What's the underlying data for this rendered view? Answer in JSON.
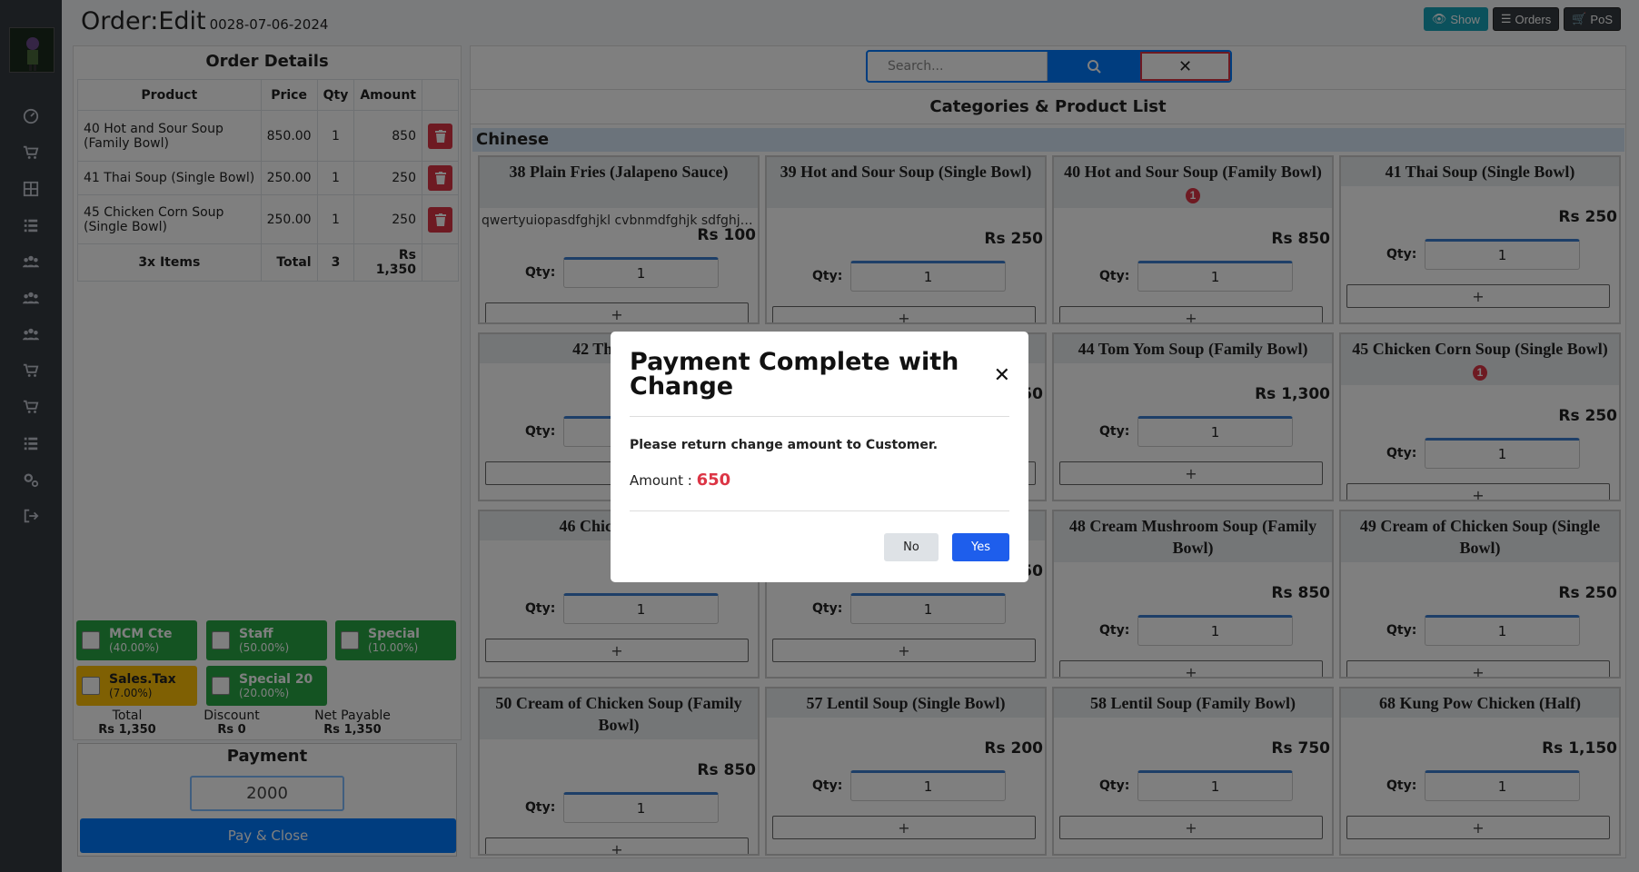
{
  "header": {
    "title": "Order:Edit",
    "order_number": "0028-07-06-2024",
    "show_label": "Show",
    "orders_label": "Orders",
    "pos_label": "PoS"
  },
  "order_panel": {
    "title": "Order Details",
    "columns": [
      "Product",
      "Price",
      "Qty",
      "Amount"
    ],
    "rows": [
      {
        "product": "40 Hot and Sour Soup (Family Bowl)",
        "price": "850.00",
        "qty": "1",
        "amount": "850"
      },
      {
        "product": "41 Thai Soup (Single Bowl)",
        "price": "250.00",
        "qty": "1",
        "amount": "250"
      },
      {
        "product": "45 Chicken Corn Soup (Single Bowl)",
        "price": "250.00",
        "qty": "1",
        "amount": "250"
      }
    ],
    "footer": {
      "items": "3x Items",
      "total_label": "Total",
      "qty": "3",
      "amount": "Rs 1,350"
    }
  },
  "discounts": [
    {
      "name": "MCM Cte",
      "percent": "(40.00%)"
    },
    {
      "name": "Staff",
      "percent": "(50.00%)"
    },
    {
      "name": "Special",
      "percent": "(10.00%)"
    },
    {
      "name": "Sales.Tax",
      "percent": "(7.00%)"
    },
    {
      "name": "Special 20",
      "percent": "(20.00%)"
    }
  ],
  "totals": {
    "total_label": "Total",
    "total_value": "Rs 1,350",
    "discount_label": "Discount",
    "discount_value": "Rs 0",
    "net_label": "Net Payable",
    "net_value": "Rs 1,350"
  },
  "payment": {
    "title": "Payment",
    "amount": "2000",
    "pay_close_label": "Pay & Close"
  },
  "search": {
    "placeholder": "Search..."
  },
  "products": {
    "title": "Categories & Product List",
    "category": "Chinese",
    "qty_label": "Qty:",
    "qty_value": "1",
    "add_label": "+",
    "cards": [
      {
        "name": "38 Plain Fries (Jalapeno Sauce)",
        "desc": "qwertyuiopasdfghjkl cvbnmdfghjk sdfghjcx...",
        "price": "Rs 100",
        "badge": ""
      },
      {
        "name": "39 Hot and Sour Soup (Single Bowl)",
        "desc": "",
        "price": "Rs 250",
        "badge": ""
      },
      {
        "name": "40 Hot and Sour Soup (Family Bowl)",
        "desc": "",
        "price": "Rs 850",
        "badge": "1"
      },
      {
        "name": "41 Thai Soup (Single Bowl)",
        "desc": "",
        "price": "Rs 250",
        "badge": ""
      },
      {
        "name": "42 Thai Soup",
        "desc": "",
        "price": "",
        "badge": ""
      },
      {
        "name": "",
        "desc": "",
        "price": "50",
        "badge": ""
      },
      {
        "name": "44 Tom Yom Soup (Family Bowl)",
        "desc": "",
        "price": "Rs 1,300",
        "badge": ""
      },
      {
        "name": "45 Chicken Corn Soup (Single Bowl)",
        "desc": "",
        "price": "Rs 250",
        "badge": "1"
      },
      {
        "name": "46 Chicken Corn",
        "desc": "",
        "price": "",
        "badge": ""
      },
      {
        "name": "",
        "desc": "",
        "price": "250",
        "badge": ""
      },
      {
        "name": "48 Cream Mushroom Soup (Family Bowl)",
        "desc": "",
        "price": "Rs 850",
        "badge": ""
      },
      {
        "name": "49 Cream of Chicken Soup (Single Bowl)",
        "desc": "",
        "price": "Rs 250",
        "badge": ""
      },
      {
        "name": "50 Cream of Chicken Soup (Family Bowl)",
        "desc": "",
        "price": "Rs 850",
        "badge": ""
      },
      {
        "name": "57 Lentil Soup (Single Bowl)",
        "desc": "",
        "price": "Rs 200",
        "badge": ""
      },
      {
        "name": "58 Lentil Soup (Family Bowl)",
        "desc": "",
        "price": "Rs 750",
        "badge": ""
      },
      {
        "name": "68 Kung Pow Chicken (Half)",
        "desc": "",
        "price": "Rs 1,150",
        "badge": ""
      }
    ]
  },
  "modal": {
    "title": "Payment Complete with Change",
    "message": "Please return change amount to Customer.",
    "amount_label": "Amount :",
    "amount_value": "650",
    "no_label": "No",
    "yes_label": "Yes"
  },
  "colors": {
    "accent": "#007bff",
    "danger": "#dc3545",
    "success": "#28a745",
    "warning": "#ffc107",
    "sidebar": "#343a40"
  }
}
